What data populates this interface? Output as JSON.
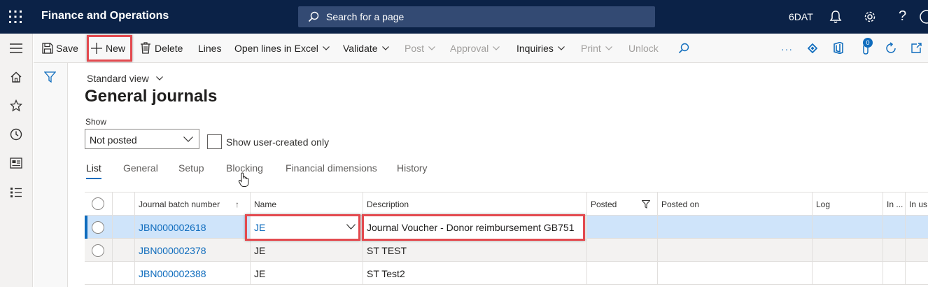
{
  "topbar": {
    "app_title": "Finance and Operations",
    "search_placeholder": "Search for a page",
    "company": "6DAT",
    "icons": [
      "waffle-icon",
      "bell-icon",
      "gear-icon",
      "help-icon",
      "account-icon"
    ],
    "bg_color": "#0b2247"
  },
  "leftnav": {
    "icons": [
      "hamburger-icon",
      "home-icon",
      "star-icon",
      "clock-icon",
      "workspace-icon",
      "list-icon"
    ]
  },
  "actionpane": {
    "save": "Save",
    "new": "New",
    "delete": "Delete",
    "lines": "Lines",
    "open_excel": "Open lines in Excel",
    "validate": "Validate",
    "post": "Post",
    "approval": "Approval",
    "inquiries": "Inquiries",
    "print": "Print",
    "unlock": "Unlock",
    "attachments_count": "0"
  },
  "page": {
    "view_name": "Standard view",
    "title": "General journals",
    "show_label": "Show",
    "show_value": "Not posted",
    "checkbox_label": "Show user-created only"
  },
  "tabs": [
    {
      "label": "List",
      "active": true
    },
    {
      "label": "General"
    },
    {
      "label": "Setup"
    },
    {
      "label": "Blocking"
    },
    {
      "label": "Financial dimensions"
    },
    {
      "label": "History"
    }
  ],
  "grid": {
    "columns": [
      "Journal batch number",
      "Name",
      "Description",
      "Posted",
      "Posted on",
      "Log",
      "In ...",
      "In us"
    ],
    "sort_indicator": "↑",
    "rows": [
      {
        "batch": "JBN000002618",
        "name": "JE",
        "description": "Journal Voucher - Donor reimbursement GB751",
        "selected": true
      },
      {
        "batch": "JBN000002378",
        "name": "JE",
        "description": "ST TEST"
      },
      {
        "batch": "JBN000002388",
        "name": "JE",
        "description": "ST Test2"
      }
    ]
  },
  "colors": {
    "accent": "#0f6cbd",
    "highlight": "#e34a4f",
    "selected_row": "#cfe4fa",
    "alt_row": "#f3f2f1"
  }
}
